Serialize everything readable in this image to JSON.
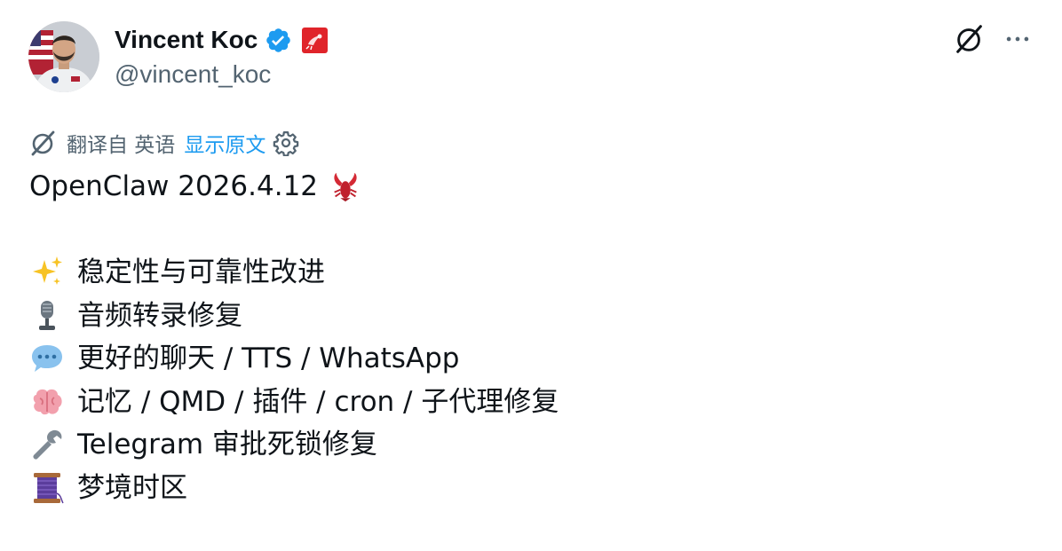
{
  "author": {
    "display_name": "Vincent Koc",
    "handle": "@vincent_koc",
    "verified_icon": "verified-badge-icon",
    "affiliate_icon": "lobster-flag-icon"
  },
  "header_actions": {
    "grok_icon": "grok-icon",
    "more_icon": "more-dots-icon"
  },
  "translation": {
    "label": "翻译自 英语",
    "show_original": "显示原文",
    "settings_icon": "gear-icon"
  },
  "tweet": {
    "title": "OpenClaw 2026.4.12",
    "title_emoji": "lobster",
    "lines": [
      {
        "emoji": "sparkles",
        "text": "稳定性与可靠性改进"
      },
      {
        "emoji": "microphone",
        "text": "音频转录修复"
      },
      {
        "emoji": "speech-balloon",
        "text": "更好的聊天 / TTS / WhatsApp"
      },
      {
        "emoji": "brain",
        "text": "记忆 / QMD / 插件 / cron / 子代理修复"
      },
      {
        "emoji": "wrench",
        "text": "Telegram 审批死锁修复"
      },
      {
        "emoji": "thread-spool",
        "text": "梦境时区"
      }
    ]
  },
  "colors": {
    "text_primary": "#0f1419",
    "text_secondary": "#536471",
    "link_blue": "#1d9bf0",
    "verified_blue": "#1d9bf0"
  }
}
